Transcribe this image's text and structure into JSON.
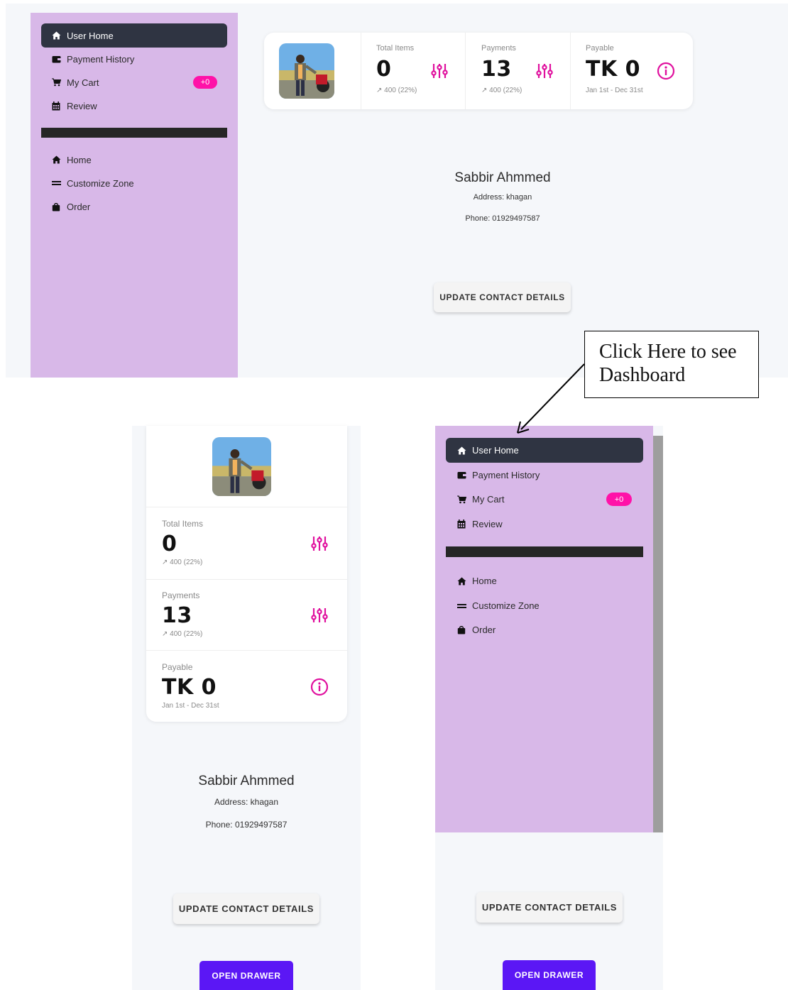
{
  "sidebar": {
    "items": [
      {
        "label": "User Home",
        "icon": "home-icon",
        "active": true
      },
      {
        "label": "Payment History",
        "icon": "wallet-icon"
      },
      {
        "label": "My Cart",
        "icon": "cart-icon",
        "badge": "+0"
      },
      {
        "label": "Review",
        "icon": "calendar-icon"
      }
    ],
    "secondary_items": [
      {
        "label": "Home",
        "icon": "home-icon"
      },
      {
        "label": "Customize Zone",
        "icon": "equals-icon"
      },
      {
        "label": "Order",
        "icon": "bag-icon"
      }
    ]
  },
  "stats": [
    {
      "label": "Total Items",
      "value": "0",
      "sub": "↗ 400 (22%)",
      "icon": "sliders-icon"
    },
    {
      "label": "Payments",
      "value": "13",
      "sub": "↗ 400 (22%)",
      "icon": "sliders-icon"
    },
    {
      "label": "Payable",
      "value": "TK 0",
      "sub": "Jan 1st - Dec 31st",
      "icon": "info-icon"
    }
  ],
  "profile": {
    "name": "Sabbir Ahmmed",
    "address": "Address: khagan",
    "phone": "Phone: 01929497587"
  },
  "buttons": {
    "update_contact": "UPDATE CONTACT DETAILS",
    "open_drawer": "OPEN DRAWER"
  },
  "annotation": {
    "line1": "Click Here to see",
    "line2": "Dashboard"
  },
  "colors": {
    "sidebar_bg": "#d8b8e8",
    "active_item": "#2f3442",
    "accent_pink": "#ff12a8",
    "icon_magenta": "#e0109e",
    "primary_button": "#5b17f5"
  }
}
